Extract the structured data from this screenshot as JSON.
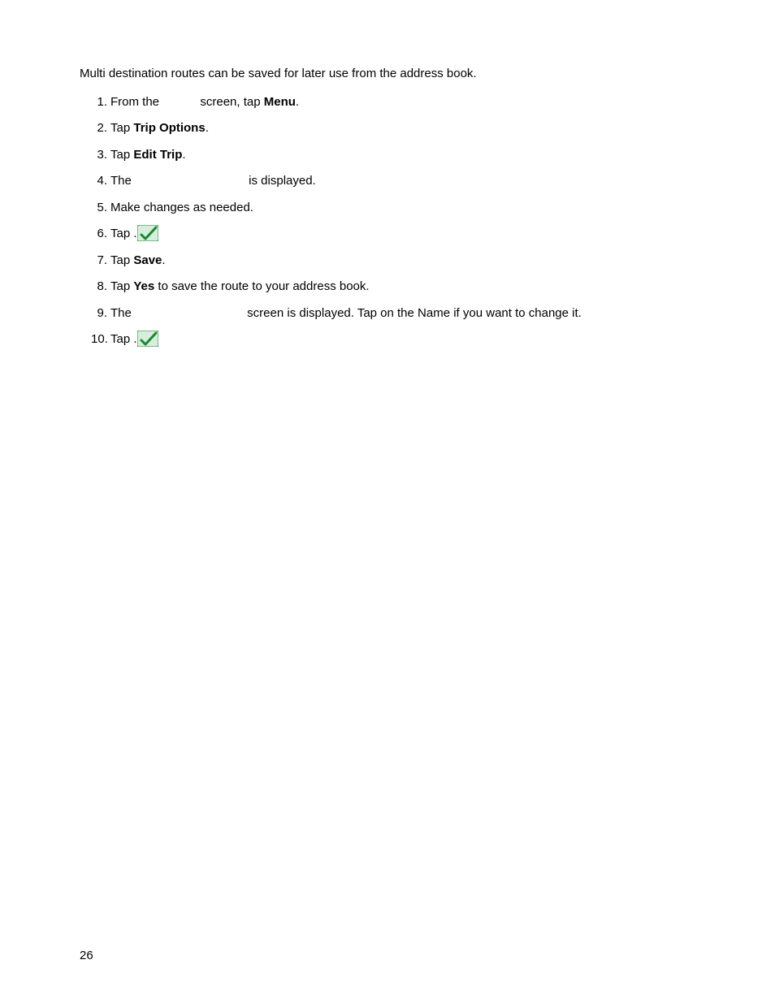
{
  "intro": "Multi destination routes can be saved for later use from the address book.",
  "steps": {
    "s1": {
      "before": "From the ",
      "after": " screen, tap ",
      "menu": "Menu",
      "period": "."
    },
    "s2": {
      "tap": "Tap ",
      "label": "Trip Options",
      "period": "."
    },
    "s3": {
      "tap": "Tap ",
      "label": "Edit Trip",
      "period": "."
    },
    "s4": {
      "before": "The ",
      "after": " is displayed."
    },
    "s5": {
      "text": "Make changes as needed."
    },
    "s6": {
      "tap": "Tap "
    },
    "s7": {
      "tap": "Tap ",
      "label": "Save",
      "period": "."
    },
    "s8": {
      "tap": "Tap ",
      "label": "Yes",
      "after": " to save the route to your address book."
    },
    "s9": {
      "before": "The ",
      "after": " screen is displayed.  Tap on the Name if you want to change it."
    },
    "s10": {
      "tap": "Tap "
    }
  },
  "page_number": "26",
  "icons": {
    "checkmark": "checkmark-icon"
  }
}
